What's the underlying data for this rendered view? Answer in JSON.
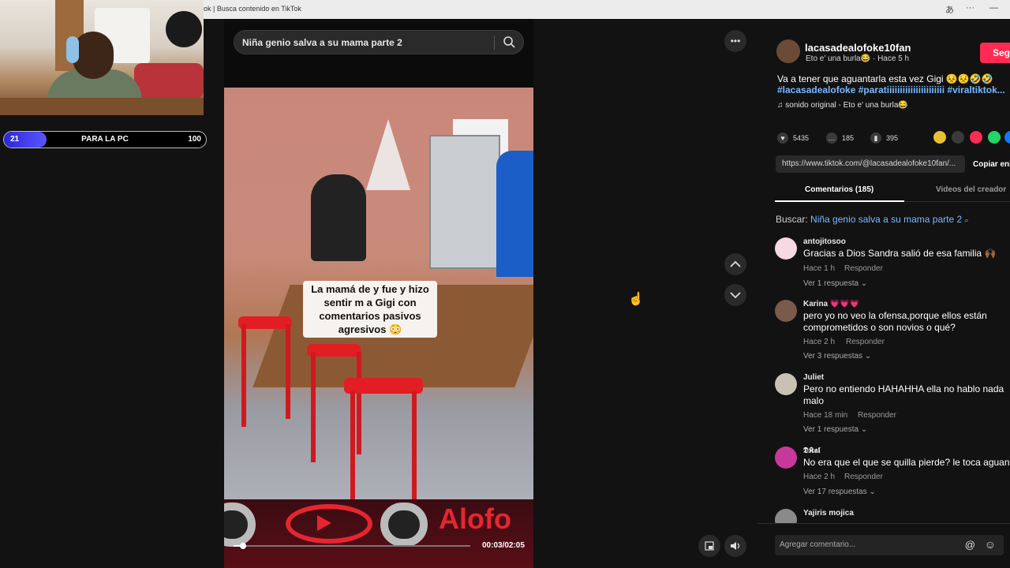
{
  "browser": {
    "tab_title": "ok | Busca contenido en TikTok",
    "ctrl_font_icon": "あ",
    "ctrl_more": "···",
    "ctrl_min": "—"
  },
  "overlay": {
    "goal": {
      "label": "PARA LA PC",
      "min": "21",
      "max": "100",
      "progress_fraction": 0.21
    }
  },
  "search": {
    "value": "Niña genio salva a su mama parte 2"
  },
  "video": {
    "caption": "La mamá de      y fue y hizo sentir m     a Gigi con comentarios pasivos agresivos 😳",
    "brand": "Alofo",
    "time": "00:03/02:05",
    "progress_fraction": 0.04
  },
  "author": {
    "username": "lacasadealofoke10fan",
    "meta": "Eto e' una burla😂 · Hace 5 h",
    "follow_label": "Segu"
  },
  "post": {
    "description": "Va a tener que aguantarla esta vez Gigi 😣😣🤣🤣",
    "hashtags": "#lacasadealofoke #paratiiiiiiiiiiiiiiiiiiiiii #viraltiktok...",
    "music": "♫  sonido original - Eto e' una burla😂"
  },
  "stats": {
    "likes": "5435",
    "comments": "185",
    "saves": "395"
  },
  "link": {
    "url": "https://www.tiktok.com/@lacasadealofoke10fan/...",
    "copy_label": "Copiar enl"
  },
  "tabs": {
    "comments": "Comentarios (185)",
    "creator": "Videos del creador"
  },
  "search_hint": {
    "prefix": "Buscar:",
    "term": "Niña genio salva a su mama parte 2"
  },
  "comments": [
    {
      "user": "antojitosoo",
      "text": "Gracias a Dios Sandra salió de esa familia 🙌🏾",
      "time": "Hace 1 h",
      "reply": "Responder",
      "replies": "Ver 1 respuesta ⌄"
    },
    {
      "user": "Karina 💗💗💗",
      "text": "pero yo no veo la ofensa,porque ellos están comprometidos o son novios o qué?",
      "time": "Hace 2 h",
      "reply": "Responder",
      "replies": "Ver 3 respuestas ⌄"
    },
    {
      "user": "Juliet",
      "text": "Pero no entiendo HAHAHHA ella no hablo nada malo",
      "time": "Hace 18 min",
      "reply": "Responder",
      "replies": "Ver 1 respuesta ⌄"
    },
    {
      "user": "𝕯𝕶𝖆𝖑",
      "text": "No era que el que se quilla pierde? le toca aguantar",
      "time": "Hace 2 h",
      "reply": "Responder",
      "replies": "Ver 17 respuestas ⌄"
    },
    {
      "user": "Yajiris mojica",
      "text": "",
      "time": "",
      "reply": "",
      "replies": ""
    }
  ],
  "add_comment": {
    "placeholder": "Agregar comentario..."
  },
  "colors": {
    "accent": "#fe2c55",
    "link": "#7ab8ff",
    "goal": "#2a27d8"
  }
}
